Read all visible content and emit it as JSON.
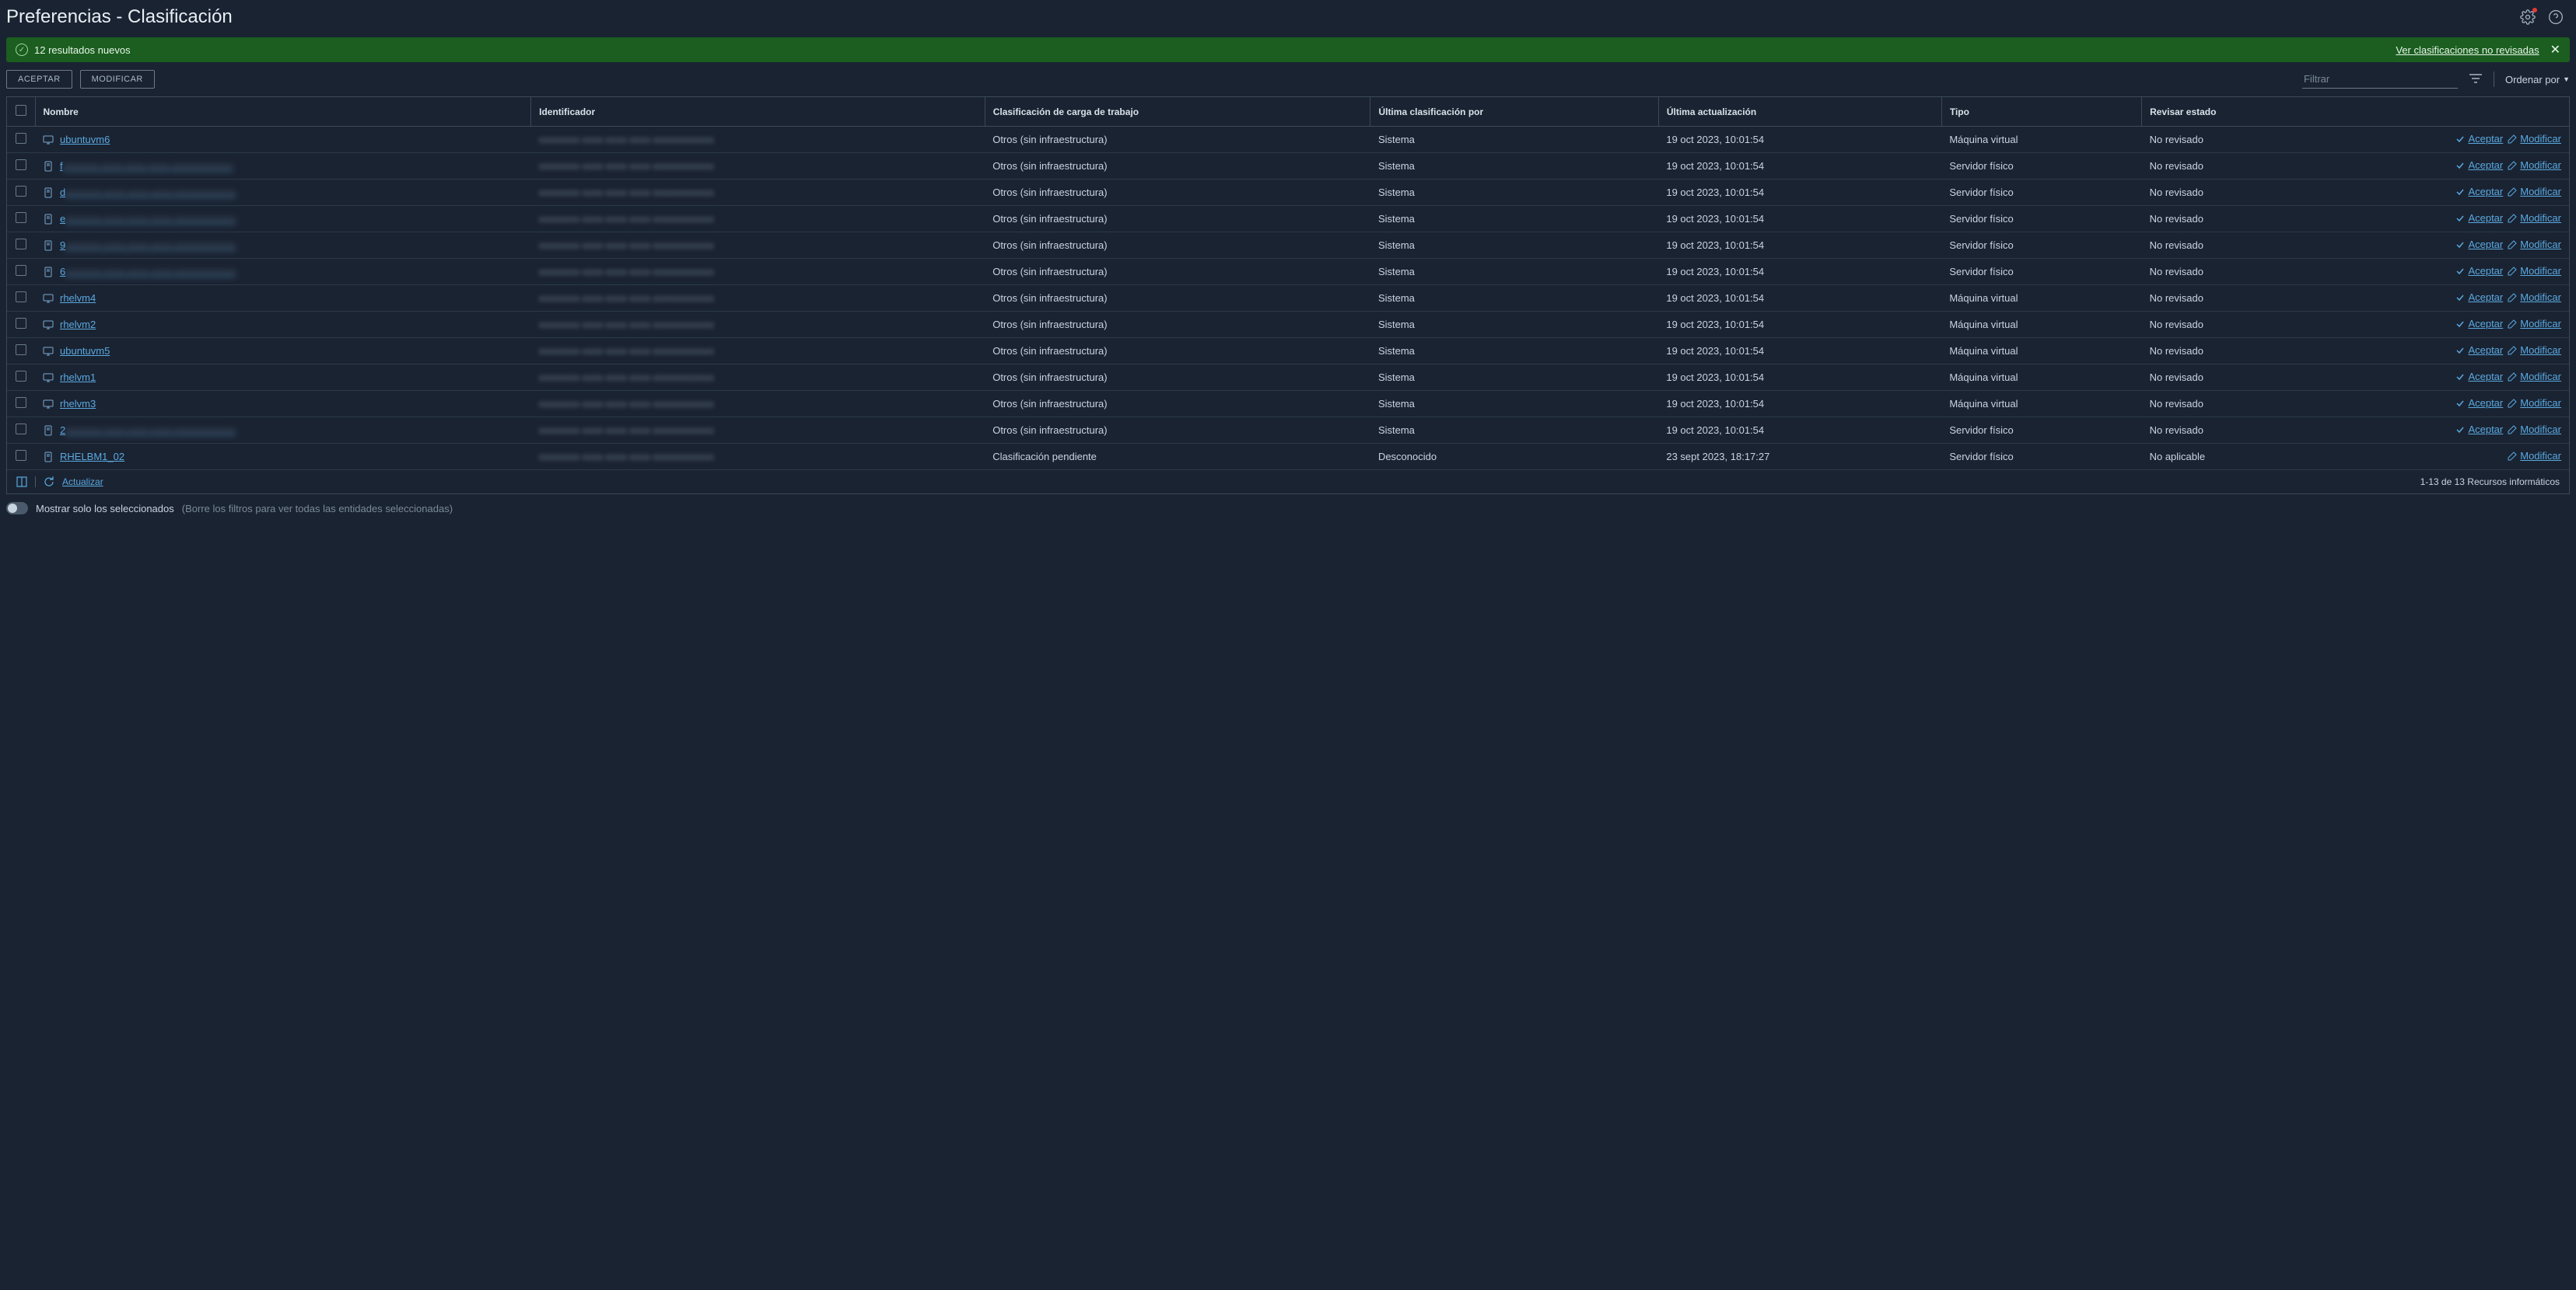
{
  "header": {
    "title": "Preferencias - Clasificación"
  },
  "banner": {
    "message": "12 resultados nuevos",
    "link": "Ver clasificaciones no revisadas"
  },
  "toolbar": {
    "accept": "ACEPTAR",
    "modify": "MODIFICAR",
    "filter_placeholder": "Filtrar",
    "sort_label": "Ordenar por"
  },
  "columns": {
    "name": "Nombre",
    "identifier": "Identificador",
    "workload": "Clasificación de carga de trabajo",
    "classified_by": "Última clasificación por",
    "updated": "Última actualización",
    "type": "Tipo",
    "review": "Revisar estado"
  },
  "actions": {
    "accept": "Aceptar",
    "modify": "Modificar"
  },
  "rows": [
    {
      "name": "ubuntuvm6",
      "name_blurred": false,
      "id": "xxxxxxxx-xxxx-xxxx-xxxx-xxxxxxxxxxxx",
      "workload": "Otros (sin infraestructura)",
      "by": "Sistema",
      "updated": "19 oct 2023, 10:01:54",
      "type": "Máquina virtual",
      "review": "No revisado",
      "icon": "vm",
      "show_accept": true
    },
    {
      "name": "fxxxxxxx-xxxx-xxxx-xxxx-xxxxxxxxxxxx",
      "name_blurred": true,
      "prefix": "f",
      "id": "xxxxxxxx-xxxx-xxxx-xxxx-xxxxxxxxxxxx",
      "workload": "Otros (sin infraestructura)",
      "by": "Sistema",
      "updated": "19 oct 2023, 10:01:54",
      "type": "Servidor físico",
      "review": "No revisado",
      "icon": "server",
      "show_accept": true
    },
    {
      "name": "dxxxxxxx-xxxx-xxxx-xxxx-xxxxxxxxxxxx",
      "name_blurred": true,
      "prefix": "d",
      "id": "xxxxxxxx-xxxx-xxxx-xxxx-xxxxxxxxxxxx",
      "workload": "Otros (sin infraestructura)",
      "by": "Sistema",
      "updated": "19 oct 2023, 10:01:54",
      "type": "Servidor físico",
      "review": "No revisado",
      "icon": "server",
      "show_accept": true
    },
    {
      "name": "exxxxxxx-xxxx-xxxx-xxxx-xxxxxxxxxxxx",
      "name_blurred": true,
      "prefix": "e",
      "id": "xxxxxxxx-xxxx-xxxx-xxxx-xxxxxxxxxxxx",
      "workload": "Otros (sin infraestructura)",
      "by": "Sistema",
      "updated": "19 oct 2023, 10:01:54",
      "type": "Servidor físico",
      "review": "No revisado",
      "icon": "server",
      "show_accept": true
    },
    {
      "name": "9xxxxxxx-xxxx-xxxx-xxxx-xxxxxxxxxxxx",
      "name_blurred": true,
      "prefix": "9",
      "id": "xxxxxxxx-xxxx-xxxx-xxxx-xxxxxxxxxxxx",
      "workload": "Otros (sin infraestructura)",
      "by": "Sistema",
      "updated": "19 oct 2023, 10:01:54",
      "type": "Servidor físico",
      "review": "No revisado",
      "icon": "server",
      "show_accept": true
    },
    {
      "name": "6xxxxxxx-xxxx-xxxx-xxxx-xxxxxxxxxxxx",
      "name_blurred": true,
      "prefix": "6",
      "id": "xxxxxxxx-xxxx-xxxx-xxxx-xxxxxxxxxxxx",
      "workload": "Otros (sin infraestructura)",
      "by": "Sistema",
      "updated": "19 oct 2023, 10:01:54",
      "type": "Servidor físico",
      "review": "No revisado",
      "icon": "server",
      "show_accept": true
    },
    {
      "name": "rhelvm4",
      "name_blurred": false,
      "id": "xxxxxxxx-xxxx-xxxx-xxxx-xxxxxxxxxxxx",
      "workload": "Otros (sin infraestructura)",
      "by": "Sistema",
      "updated": "19 oct 2023, 10:01:54",
      "type": "Máquina virtual",
      "review": "No revisado",
      "icon": "vm",
      "show_accept": true
    },
    {
      "name": "rhelvm2",
      "name_blurred": false,
      "id": "xxxxxxxx-xxxx-xxxx-xxxx-xxxxxxxxxxxx",
      "workload": "Otros (sin infraestructura)",
      "by": "Sistema",
      "updated": "19 oct 2023, 10:01:54",
      "type": "Máquina virtual",
      "review": "No revisado",
      "icon": "vm",
      "show_accept": true
    },
    {
      "name": "ubuntuvm5",
      "name_blurred": false,
      "id": "xxxxxxxx-xxxx-xxxx-xxxx-xxxxxxxxxxxx",
      "workload": "Otros (sin infraestructura)",
      "by": "Sistema",
      "updated": "19 oct 2023, 10:01:54",
      "type": "Máquina virtual",
      "review": "No revisado",
      "icon": "vm",
      "show_accept": true
    },
    {
      "name": "rhelvm1",
      "name_blurred": false,
      "id": "xxxxxxxx-xxxx-xxxx-xxxx-xxxxxxxxxxxx",
      "workload": "Otros (sin infraestructura)",
      "by": "Sistema",
      "updated": "19 oct 2023, 10:01:54",
      "type": "Máquina virtual",
      "review": "No revisado",
      "icon": "vm",
      "show_accept": true
    },
    {
      "name": "rhelvm3",
      "name_blurred": false,
      "id": "xxxxxxxx-xxxx-xxxx-xxxx-xxxxxxxxxxxx",
      "workload": "Otros (sin infraestructura)",
      "by": "Sistema",
      "updated": "19 oct 2023, 10:01:54",
      "type": "Máquina virtual",
      "review": "No revisado",
      "icon": "vm",
      "show_accept": true
    },
    {
      "name": "2xxxxxxx-xxxx-xxxx-xxxx-xxxxxxxxxxxx",
      "name_blurred": true,
      "prefix": "2",
      "id": "xxxxxxxx-xxxx-xxxx-xxxx-xxxxxxxxxxxx",
      "workload": "Otros (sin infraestructura)",
      "by": "Sistema",
      "updated": "19 oct 2023, 10:01:54",
      "type": "Servidor físico",
      "review": "No revisado",
      "icon": "server",
      "show_accept": true
    },
    {
      "name": "RHELBM1_02",
      "name_blurred": false,
      "id": "xxxxxxxx-xxxx-xxxx-xxxx-xxxxxxxxxxxx",
      "workload": "Clasificación pendiente",
      "by": "Desconocido",
      "updated": "23 sept 2023, 18:17:27",
      "type": "Servidor físico",
      "review": "No aplicable",
      "icon": "server",
      "show_accept": false
    }
  ],
  "footer": {
    "refresh": "Actualizar",
    "pagination": "1-13 de 13 Recursos informáticos"
  },
  "bottom": {
    "toggle_label": "Mostrar solo los seleccionados",
    "hint": "(Borre los filtros para ver todas las entidades seleccionadas)"
  }
}
